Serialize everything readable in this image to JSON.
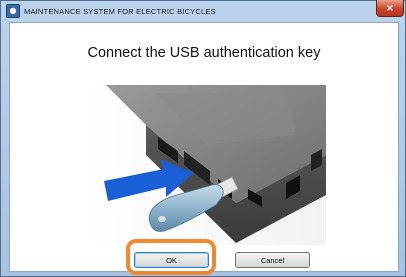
{
  "window": {
    "title": "MAINTENANCE SYSTEM FOR ELECTRIC BICYCLES",
    "close_glyph": "×"
  },
  "dialog": {
    "heading": "Connect the USB authentication key",
    "ok_label": "OK",
    "cancel_label": "Cancel"
  },
  "colors": {
    "highlight": "#f08a2e",
    "arrow": "#1a5fd6",
    "usb_key": "#8eb4cc"
  },
  "icons": {
    "app": "app-icon",
    "close": "close-icon",
    "arrow": "arrow-right-icon"
  }
}
